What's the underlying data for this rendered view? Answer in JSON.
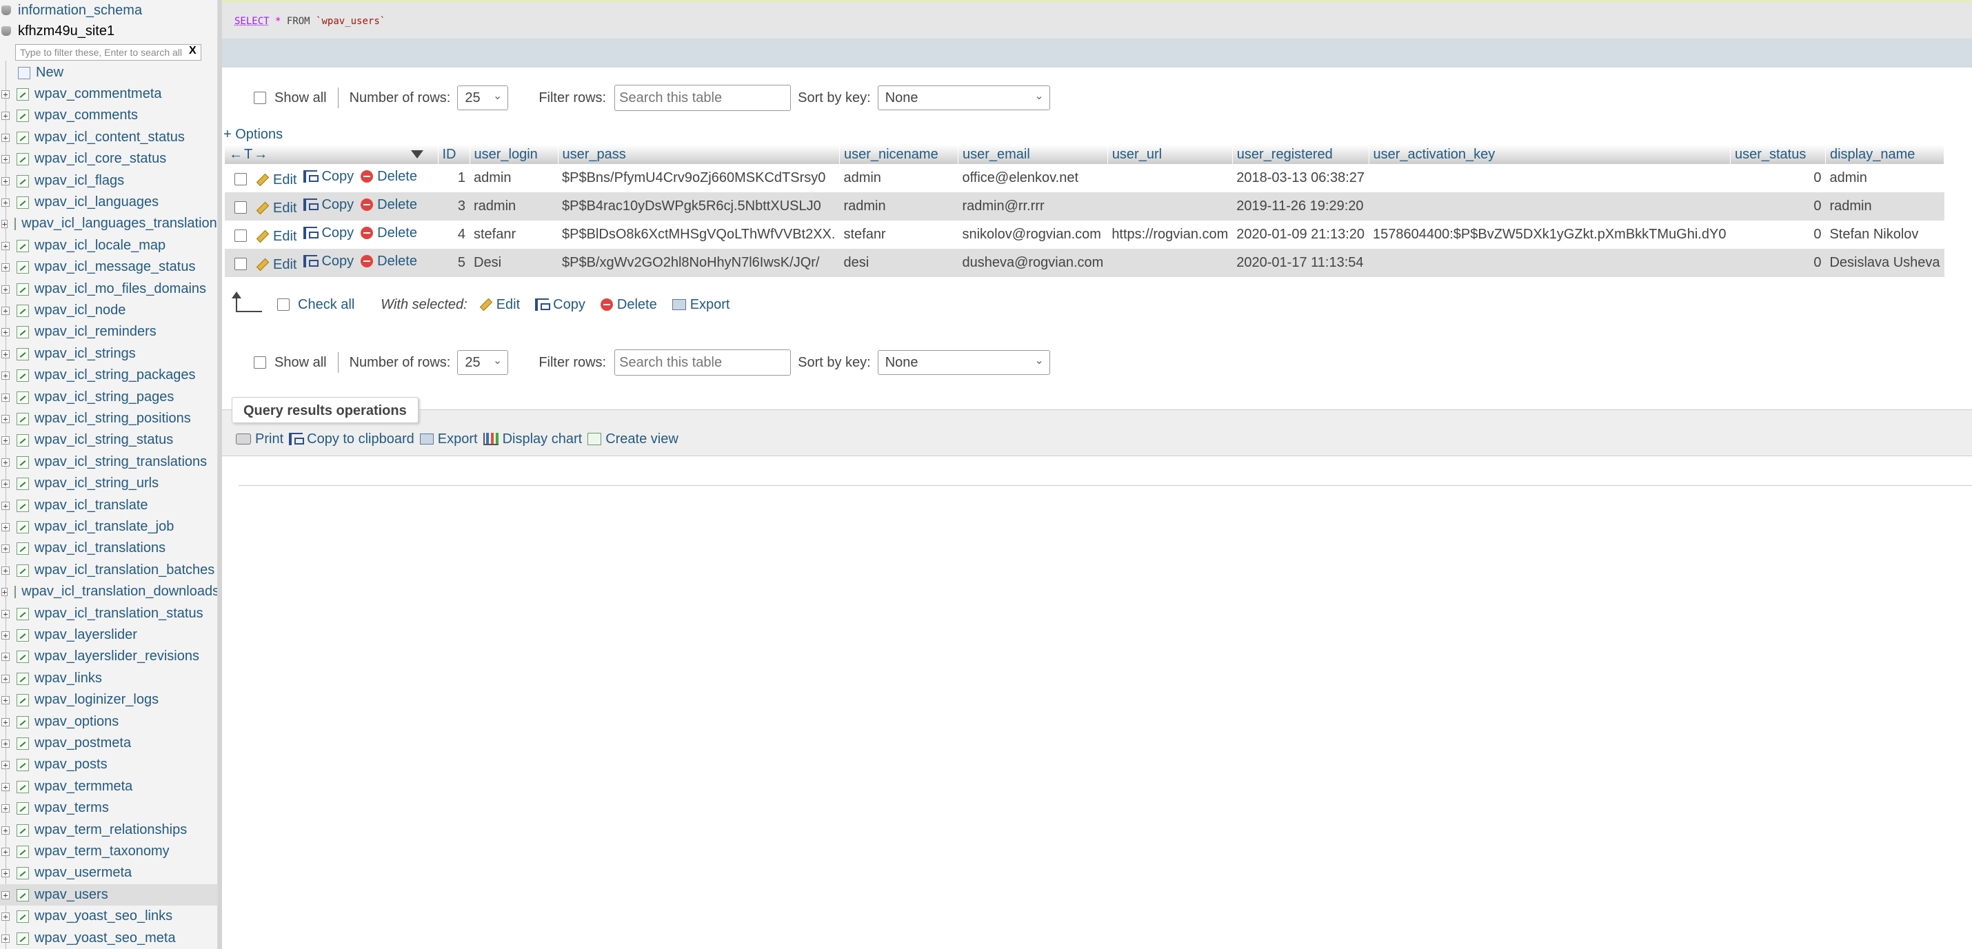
{
  "sidebar": {
    "databases": [
      {
        "name": "information_schema"
      },
      {
        "name": "kfhzm49u_site1"
      }
    ],
    "filter_placeholder": "Type to filter these, Enter to search all",
    "filter_clear": "X",
    "new_label": "New",
    "tables": [
      "wpav_commentmeta",
      "wpav_comments",
      "wpav_icl_content_status",
      "wpav_icl_core_status",
      "wpav_icl_flags",
      "wpav_icl_languages",
      "wpav_icl_languages_translations",
      "wpav_icl_locale_map",
      "wpav_icl_message_status",
      "wpav_icl_mo_files_domains",
      "wpav_icl_node",
      "wpav_icl_reminders",
      "wpav_icl_strings",
      "wpav_icl_string_packages",
      "wpav_icl_string_pages",
      "wpav_icl_string_positions",
      "wpav_icl_string_status",
      "wpav_icl_string_translations",
      "wpav_icl_string_urls",
      "wpav_icl_translate",
      "wpav_icl_translate_job",
      "wpav_icl_translations",
      "wpav_icl_translation_batches",
      "wpav_icl_translation_downloads",
      "wpav_icl_translation_status",
      "wpav_layerslider",
      "wpav_layerslider_revisions",
      "wpav_links",
      "wpav_loginizer_logs",
      "wpav_options",
      "wpav_postmeta",
      "wpav_posts",
      "wpav_termmeta",
      "wpav_terms",
      "wpav_term_relationships",
      "wpav_term_taxonomy",
      "wpav_usermeta",
      "wpav_users",
      "wpav_yoast_seo_links",
      "wpav_yoast_seo_meta"
    ],
    "active_table": "wpav_users",
    "expander_symbol": "+"
  },
  "sql": {
    "select": "SELECT",
    "star": "*",
    "from": "FROM",
    "table": "`wpav_users`"
  },
  "nav": {
    "show_all": "Show all",
    "number_of_rows": "Number of rows:",
    "rows_value": "25",
    "filter_rows": "Filter rows:",
    "search_placeholder": "Search this table",
    "sort_by_key": "Sort by key:",
    "sort_value": "None"
  },
  "options_link": "+ Options",
  "grid": {
    "header_arrows": "←T→",
    "columns": [
      "ID",
      "user_login",
      "user_pass",
      "user_nicename",
      "user_email",
      "user_url",
      "user_registered",
      "user_activation_key",
      "user_status",
      "display_name"
    ],
    "actions": {
      "edit": "Edit",
      "copy": "Copy",
      "delete": "Delete"
    },
    "rows": [
      {
        "ID": "1",
        "user_login": "admin",
        "user_pass": "$P$Bns/PfymU4Crv9oZj660MSKCdTSrsy0",
        "user_nicename": "admin",
        "user_email": "office@elenkov.net",
        "user_url": "",
        "user_registered": "2018-03-13 06:38:27",
        "user_activation_key": "",
        "user_status": "0",
        "display_name": "admin"
      },
      {
        "ID": "3",
        "user_login": "radmin",
        "user_pass": "$P$B4rac10yDsWPgk5R6cj.5NbttXUSLJ0",
        "user_nicename": "radmin",
        "user_email": "radmin@rr.rrr",
        "user_url": "",
        "user_registered": "2019-11-26 19:29:20",
        "user_activation_key": "",
        "user_status": "0",
        "display_name": "radmin"
      },
      {
        "ID": "4",
        "user_login": "stefanr",
        "user_pass": "$P$BlDsO8k6XctMHSgVQoLThWfVVBt2XX.",
        "user_nicename": "stefanr",
        "user_email": "snikolov@rogvian.com",
        "user_url": "https://rogvian.com",
        "user_registered": "2020-01-09 21:13:20",
        "user_activation_key": "1578604400:$P$BvZW5DXk1yGZkt.pXmBkkTMuGhi.dY0",
        "user_status": "0",
        "display_name": "Stefan Nikolov"
      },
      {
        "ID": "5",
        "user_login": "Desi",
        "user_pass": "$P$B/xgWv2GO2hl8NoHhyN7l6IwsK/JQr/",
        "user_nicename": "desi",
        "user_email": "dusheva@rogvian.com",
        "user_url": "",
        "user_registered": "2020-01-17 11:13:54",
        "user_activation_key": "",
        "user_status": "0",
        "display_name": "Desislava Usheva"
      }
    ]
  },
  "bulk": {
    "check_all": "Check all",
    "with_selected": "With selected:",
    "edit": "Edit",
    "copy": "Copy",
    "delete": "Delete",
    "export": "Export"
  },
  "query_ops": {
    "legend": "Query results operations",
    "print": "Print",
    "copy_clipboard": "Copy to clipboard",
    "export": "Export",
    "display_chart": "Display chart",
    "create_view": "Create view"
  }
}
